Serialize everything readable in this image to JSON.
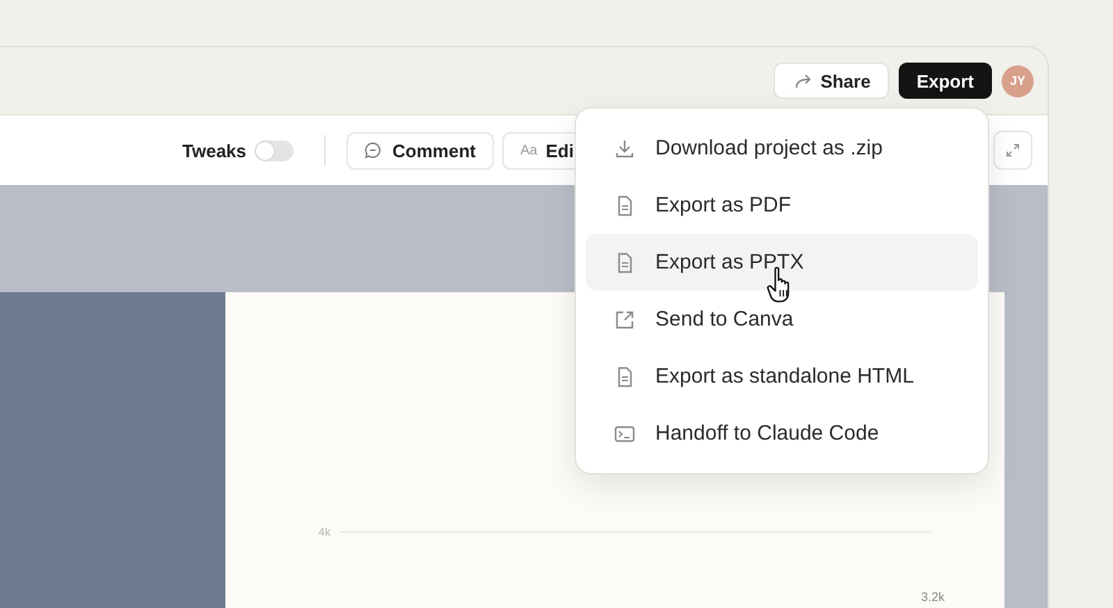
{
  "titlebar": {
    "share_button": "Share",
    "export_button": "Export",
    "avatar_initials": "JY"
  },
  "toolbar": {
    "tweaks": {
      "label": "Tweaks",
      "on": false
    },
    "comment_button": "Comment",
    "edit_button": {
      "icon_text": "Aa",
      "label": "Edi"
    }
  },
  "slide": {
    "axis_label": "4k",
    "value_label": "3.2k"
  },
  "export_menu": {
    "items": [
      {
        "kind": "download",
        "label": "Download project as .zip",
        "selected": false
      },
      {
        "kind": "document",
        "label": "Export as PDF",
        "selected": false
      },
      {
        "kind": "document",
        "label": "Export as PPTX",
        "selected": true
      },
      {
        "kind": "external",
        "label": "Send to Canva",
        "selected": false
      },
      {
        "kind": "document",
        "label": "Export as standalone HTML",
        "selected": false
      },
      {
        "kind": "terminal",
        "label": "Handoff to Claude Code",
        "selected": false
      }
    ]
  }
}
